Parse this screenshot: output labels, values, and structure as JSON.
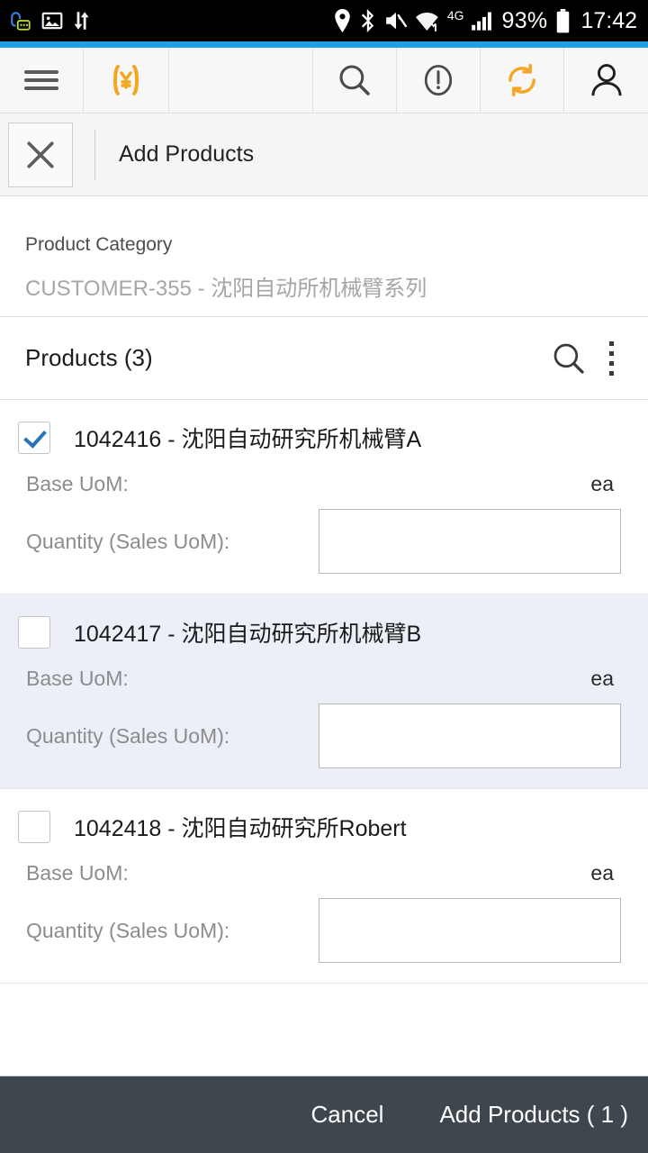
{
  "status_bar": {
    "left_icons": [
      "voicemail-message-icon",
      "image-icon",
      "data-transfer-icon"
    ],
    "location_icon": "location-pin-icon",
    "bluetooth_icon": "bluetooth-icon",
    "mute_icon": "speaker-mute-icon",
    "wifi_icon": "wifi-icon",
    "network_type": "4G",
    "signal_icon": "signal-bars-icon",
    "battery_percent": "93%",
    "battery_icon": "battery-icon",
    "clock": "17:42"
  },
  "toolbar": {
    "menu_icon": "hamburger-menu-icon",
    "logo_mark": "(¥)",
    "search_icon": "search-icon",
    "alert_icon": "exclamation-circle-icon",
    "sync_icon": "sync-icon",
    "account_icon": "person-icon",
    "accent_color": "#1e9fe3",
    "logo_color": "#f5a623"
  },
  "page_header": {
    "close_icon": "close-icon",
    "title": "Add Products"
  },
  "category": {
    "label": "Product Category",
    "value": "CUSTOMER-355 - 沈阳自动所机械臂系列"
  },
  "products_bar": {
    "title": "Products  (3)",
    "search_icon": "search-icon",
    "overflow_icon": "overflow-menu-icon"
  },
  "labels": {
    "base_uom": "Base UoM:",
    "quantity": "Quantity (Sales UoM):"
  },
  "products": [
    {
      "checked": true,
      "name": "1042416 - 沈阳自动研究所机械臂A",
      "base_uom_label": "Base UoM:",
      "base_uom_value": "ea",
      "quantity_label": "Quantity (Sales UoM):",
      "quantity_value": ""
    },
    {
      "checked": false,
      "name": "1042417 - 沈阳自动研究所机械臂B",
      "base_uom_label": "Base UoM:",
      "base_uom_value": "ea",
      "quantity_label": "Quantity (Sales UoM):",
      "quantity_value": ""
    },
    {
      "checked": false,
      "name": "1042418 - 沈阳自动研究所Robert",
      "base_uom_label": "Base UoM:",
      "base_uom_value": "ea",
      "quantity_label": "Quantity (Sales UoM):",
      "quantity_value": ""
    }
  ],
  "footer": {
    "cancel_label": "Cancel",
    "submit_label": "Add Products ( 1 )",
    "background_color": "#3e464e"
  }
}
